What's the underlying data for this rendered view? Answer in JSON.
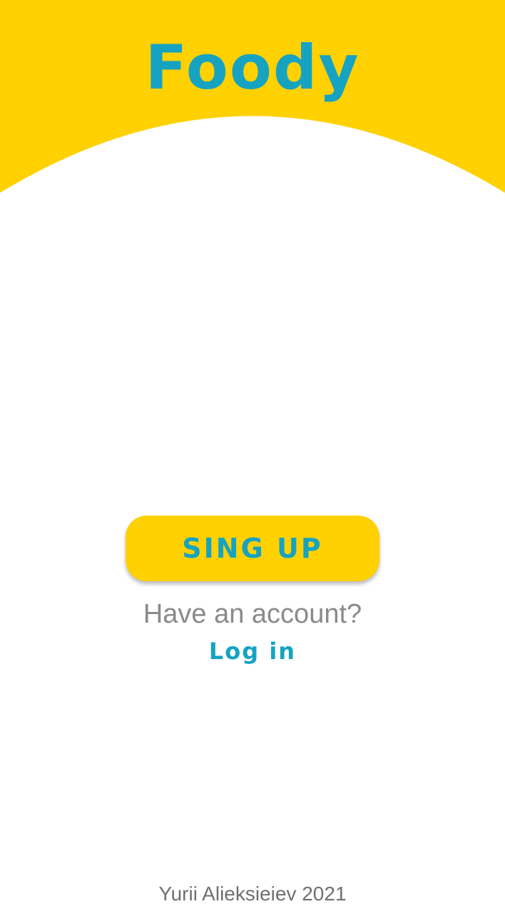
{
  "app": {
    "title": "Foody"
  },
  "actions": {
    "signup_label": "SING UP",
    "account_prompt": "Have an account?",
    "login_label": "Log in"
  },
  "footer": {
    "credit": "Yurii Alieksieiev 2021"
  },
  "colors": {
    "brand_yellow": "#FFD100",
    "accent_blue": "#16A3C2",
    "muted_gray": "#8A8A8A"
  }
}
